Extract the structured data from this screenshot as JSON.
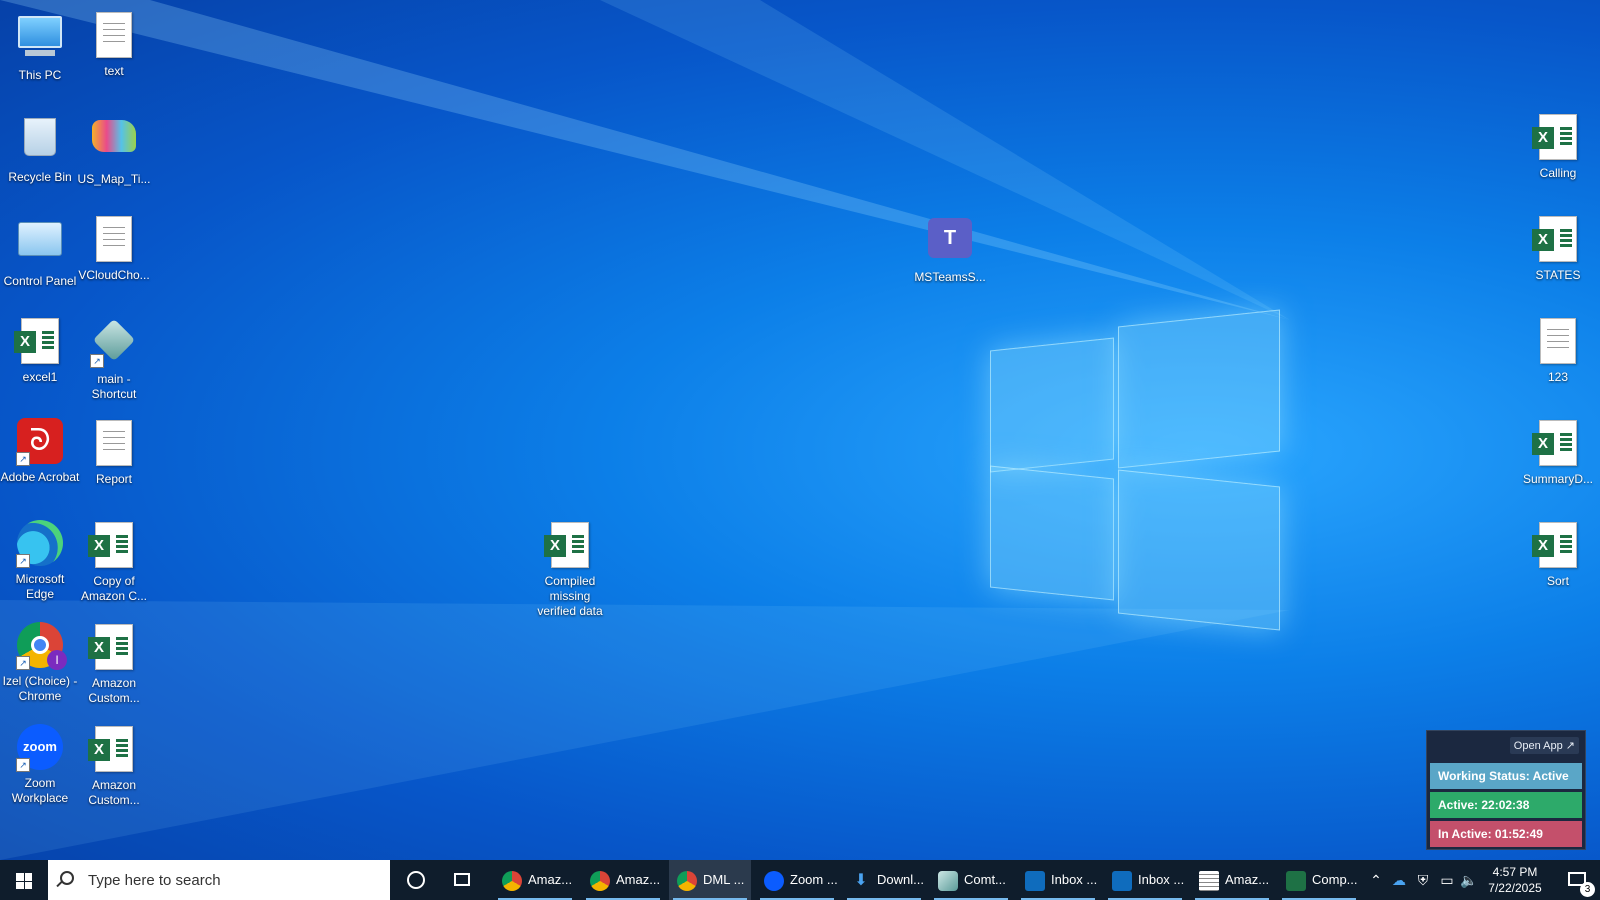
{
  "desktop": {
    "icons": {
      "this_pc": "This PC",
      "text": "text",
      "recycle_bin": "Recycle Bin",
      "us_map": "US_Map_Ti...",
      "control_panel": "Control Panel",
      "vcloud": "VCloudCho...",
      "excel1": "excel1",
      "main_shortcut": "main - Shortcut",
      "adobe": "Adobe Acrobat",
      "report": "Report",
      "edge": "Microsoft Edge",
      "copy_amazon": "Copy of Amazon C...",
      "izel_chrome": "Izel (Choice) - Chrome",
      "amazon_custom_1": "Amazon Custom...",
      "zoom": "Zoom Workplace",
      "amazon_custom_2": "Amazon Custom...",
      "compiled": "Compiled missing verified data",
      "msteams": "MSTeamsS...",
      "calling": "Calling",
      "states": "STATES",
      "num123": "123",
      "summary": "SummaryD...",
      "sort": "Sort"
    }
  },
  "widget": {
    "open_app": "Open App ↗",
    "working_status": "Working Status: Active",
    "active": "Active: 22:02:38",
    "inactive": "In Active: 01:52:49"
  },
  "taskbar": {
    "search_placeholder": "Type here to search",
    "apps": [
      {
        "label": "Amaz...",
        "icon": "chrome-icon"
      },
      {
        "label": "Amaz...",
        "icon": "chrome-icon"
      },
      {
        "label": "DML ...",
        "icon": "chrome-icon"
      },
      {
        "label": "Zoom ...",
        "icon": "zoom-icon"
      },
      {
        "label": "Downl...",
        "icon": "download-icon"
      },
      {
        "label": "Comt...",
        "icon": "app-icon"
      },
      {
        "label": "Inbox ...",
        "icon": "outlook-icon"
      },
      {
        "label": "Inbox ...",
        "icon": "outlook-icon"
      },
      {
        "label": "Amaz...",
        "icon": "spreadsheet-icon"
      },
      {
        "label": "Comp...",
        "icon": "excel-icon"
      }
    ],
    "clock": {
      "time": "4:57 PM",
      "date": "7/22/2025"
    },
    "notification_count": "3"
  }
}
